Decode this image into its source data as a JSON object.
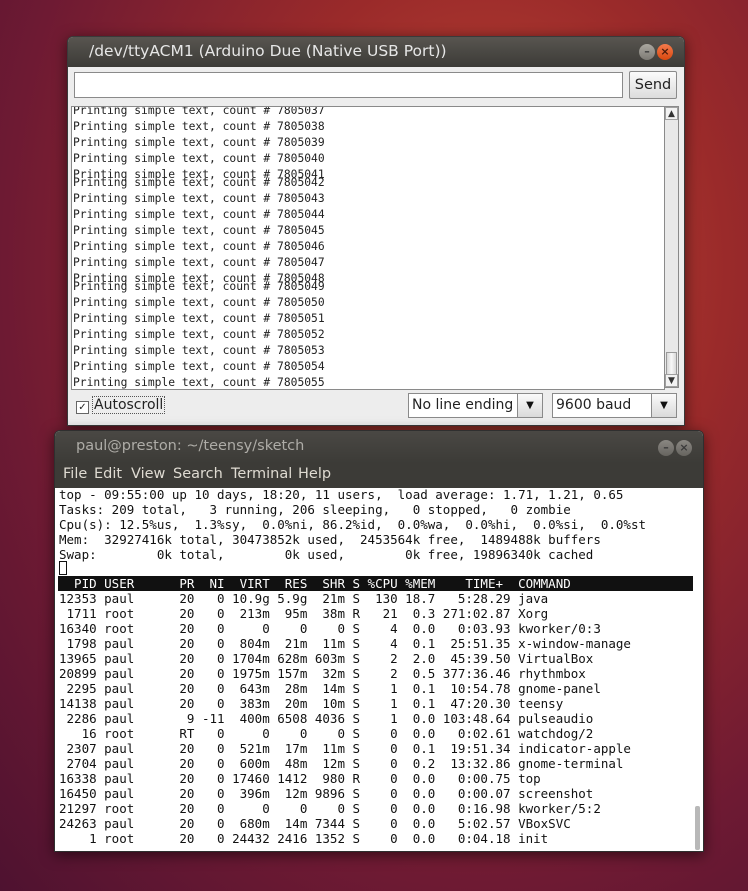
{
  "serial_monitor": {
    "title": "/dev/ttyACM1 (Arduino Due (Native USB Port))",
    "input_value": "",
    "send_label": "Send",
    "lines": [
      "Printing simple text, count # 7805037",
      "Printing simple text, count # 7805038",
      "Printing simple text, count # 7805039",
      "Printing simple text, count # 7805040",
      "Printing simple text, count # 7805041",
      "Printing simple text, count # 7805042",
      "Printing simple text, count # 7805043",
      "Printing simple text, count # 7805044",
      "Printing simple text, count # 7805045",
      "Printing simple text, count # 7805046",
      "Printing simple text, count # 7805047",
      "Printing simple text, count # 7805048",
      "Printing simple text, count # 7805049",
      "Printing simple text, count # 7805050",
      "Printing simple text, count # 7805051",
      "Printing simple text, count # 7805052",
      "Printing simple text, count # 7805053",
      "Printing simple text, count # 7805054",
      "Printing simple text, count # 7805055"
    ],
    "autoscroll_label": "Autoscroll",
    "autoscroll_checked": true,
    "line_ending": "No line ending",
    "baud": "9600 baud"
  },
  "terminal": {
    "title": "paul@preston: ~/teensy/sketch",
    "menu": [
      "File",
      "Edit",
      "View",
      "Search",
      "Terminal",
      "Help"
    ],
    "summary": [
      "top - 09:55:00 up 10 days, 18:20, 11 users,  load average: 1.71, 1.21, 0.65",
      "Tasks: 209 total,   3 running, 206 sleeping,   0 stopped,   0 zombie",
      "Cpu(s): 12.5%us,  1.3%sy,  0.0%ni, 86.2%id,  0.0%wa,  0.0%hi,  0.0%si,  0.0%st",
      "Mem:  32927416k total, 30473852k used,  2453564k free,  1489488k buffers",
      "Swap:        0k total,        0k used,        0k free, 19896340k cached"
    ],
    "header": "  PID USER      PR  NI  VIRT  RES  SHR S %CPU %MEM    TIME+  COMMAND",
    "processes": [
      "12353 paul      20   0 10.9g 5.9g  21m S  130 18.7   5:28.29 java",
      " 1711 root      20   0  213m  95m  38m R   21  0.3 271:02.87 Xorg",
      "16340 root      20   0     0    0    0 S    4  0.0   0:03.93 kworker/0:3",
      " 1798 paul      20   0  804m  21m  11m S    4  0.1  25:51.35 x-window-manage",
      "13965 paul      20   0 1704m 628m 603m S    2  2.0  45:39.50 VirtualBox",
      "20899 paul      20   0 1975m 157m  32m S    2  0.5 377:36.46 rhythmbox",
      " 2295 paul      20   0  643m  28m  14m S    1  0.1  10:54.78 gnome-panel",
      "14138 paul      20   0  383m  20m  10m S    1  0.1  47:20.30 teensy",
      " 2286 paul       9 -11  400m 6508 4036 S    1  0.0 103:48.64 pulseaudio",
      "   16 root      RT   0     0    0    0 S    0  0.0   0:02.61 watchdog/2",
      " 2307 paul      20   0  521m  17m  11m S    0  0.1  19:51.34 indicator-apple",
      " 2704 paul      20   0  600m  48m  12m S    0  0.2  13:32.86 gnome-terminal",
      "16338 paul      20   0 17460 1412  980 R    0  0.0   0:00.75 top",
      "16450 paul      20   0  396m  12m 9896 S    0  0.0   0:00.07 screenshot",
      "21297 root      20   0     0    0    0 S    0  0.0   0:16.98 kworker/5:2",
      "24263 paul      20   0  680m  14m 7344 S    0  0.0   5:02.57 VBoxSVC",
      "    1 root      20   0 24432 2416 1352 S    0  0.0   0:04.18 init"
    ]
  }
}
